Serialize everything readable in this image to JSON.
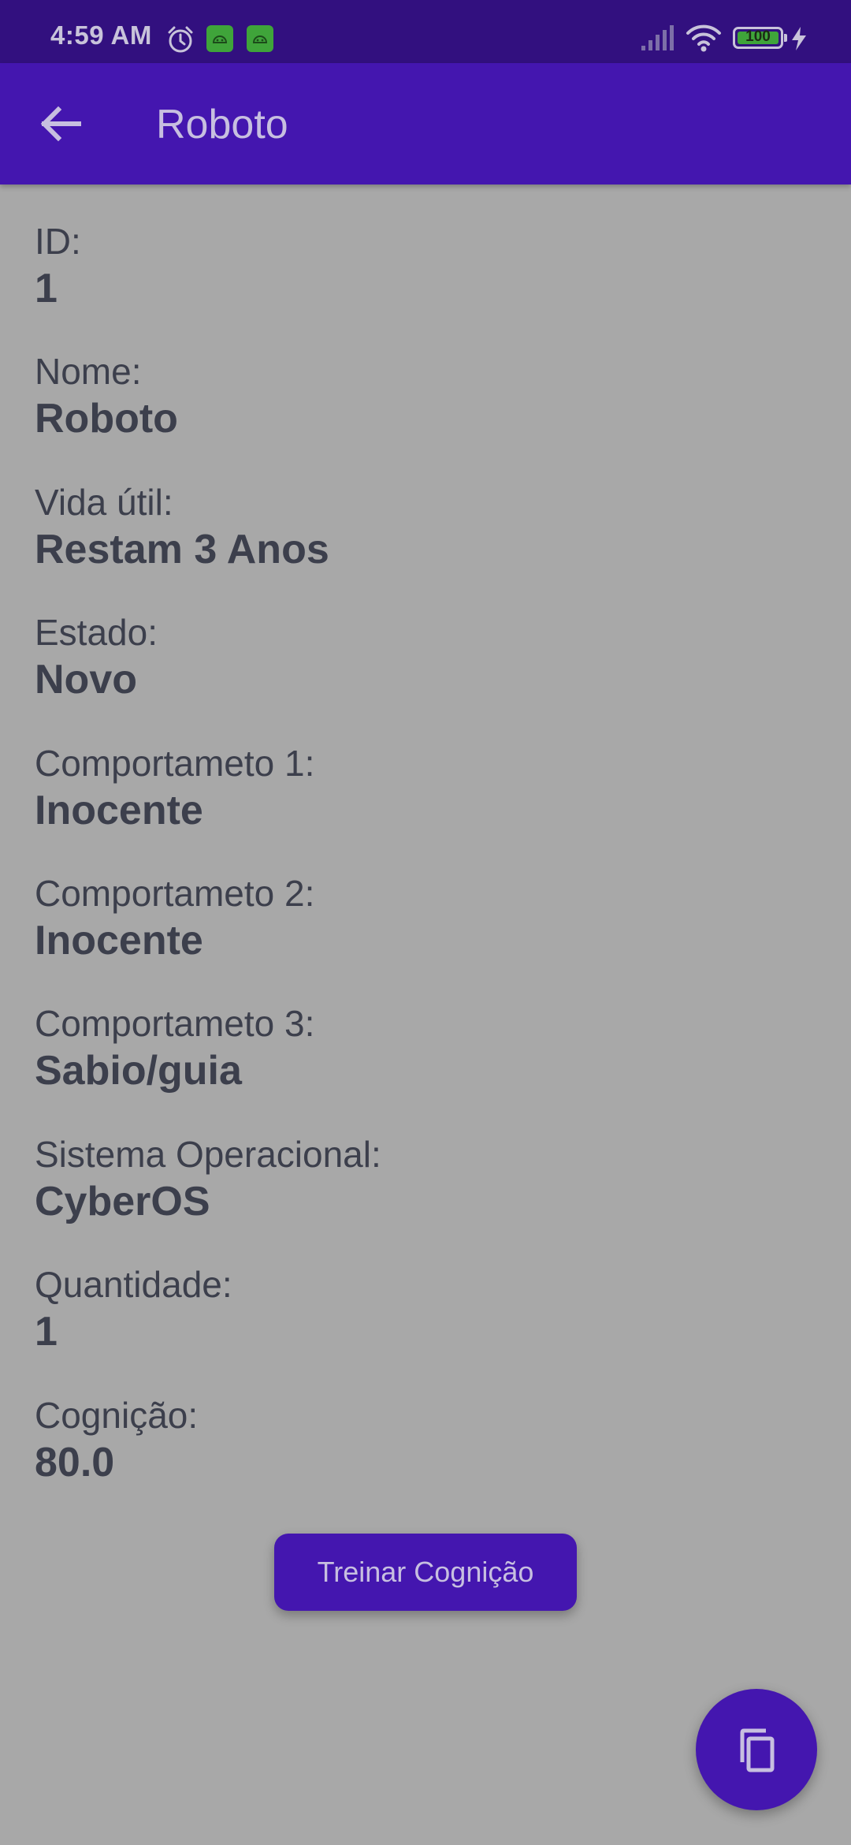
{
  "status_bar": {
    "time": "4:59 AM",
    "battery": "100",
    "icons": [
      "alarm-icon",
      "android-notification-icon",
      "android-notification-icon",
      "signal-icon",
      "wifi-icon",
      "battery-icon",
      "charging-icon"
    ]
  },
  "app_bar": {
    "title": "Roboto",
    "back_icon": "arrow-back-icon"
  },
  "fields": [
    {
      "label": "ID:",
      "value": "1"
    },
    {
      "label": "Nome:",
      "value": "Roboto"
    },
    {
      "label": "Vida útil:",
      "value": "Restam 3 Anos"
    },
    {
      "label": "Estado:",
      "value": "Novo"
    },
    {
      "label": "Comportameto 1:",
      "value": "Inocente"
    },
    {
      "label": "Comportameto 2:",
      "value": "Inocente"
    },
    {
      "label": "Comportameto 3:",
      "value": "Sabio/guia"
    },
    {
      "label": "Sistema Operacional:",
      "value": "CyberOS"
    },
    {
      "label": "Quantidade:",
      "value": "1"
    },
    {
      "label": "Cognição:",
      "value": "80.0"
    }
  ],
  "actions": {
    "train_label": "Treinar Cognição",
    "fab_icon": "copy-icon"
  },
  "colors": {
    "status_bar": "#32107f",
    "primary": "#4416af",
    "background": "#a8a8a8",
    "text": "#3c3f4c",
    "on_primary": "#c7bfe0"
  }
}
